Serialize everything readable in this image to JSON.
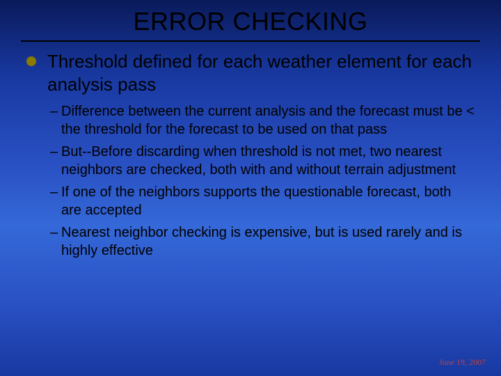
{
  "title": "ERROR CHECKING",
  "main_bullet": "Threshold defined for each weather element for each analysis pass",
  "sub_bullets": [
    "Difference between the current analysis and the forecast must be < the threshold for the forecast to be used on that pass",
    "But--Before discarding when threshold is not met, two nearest neighbors are checked, both with and without terrain adjustment",
    "If one of the neighbors supports the questionable forecast, both are accepted",
    "Nearest neighbor checking is expensive, but is used rarely and is highly effective"
  ],
  "footer_date": "June 19, 2007"
}
